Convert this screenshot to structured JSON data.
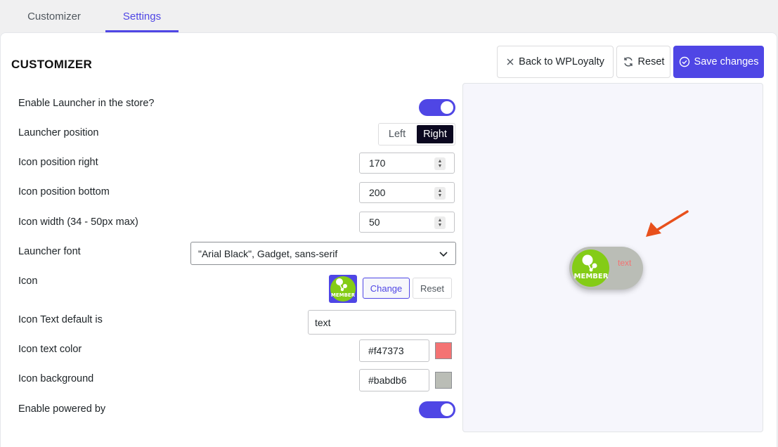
{
  "tabs": [
    {
      "label": "Customizer"
    },
    {
      "label": "Settings"
    }
  ],
  "page_title": "CUSTOMIZER",
  "actions": {
    "back": "Back to WPLoyalty",
    "reset": "Reset",
    "save": "Save changes"
  },
  "settings": {
    "enable_launcher": {
      "label": "Enable Launcher in the store?",
      "on": true
    },
    "launcher_position": {
      "label": "Launcher position",
      "options": [
        "Left",
        "Right"
      ],
      "selected": "Right"
    },
    "icon_position_right": {
      "label": "Icon position right",
      "value": "170"
    },
    "icon_position_bottom": {
      "label": "Icon position bottom",
      "value": "200"
    },
    "icon_width": {
      "label": "Icon width (34 - 50px max)",
      "value": "50"
    },
    "launcher_font": {
      "label": "Launcher font",
      "value": "\"Arial Black\", Gadget, sans-serif"
    },
    "icon": {
      "label": "Icon",
      "change": "Change",
      "reset": "Reset",
      "badge_text": "MEMBER"
    },
    "icon_text": {
      "label": "Icon Text default is",
      "value": "text"
    },
    "icon_text_color": {
      "label": "Icon text color",
      "value": "#f47373"
    },
    "icon_background": {
      "label": "Icon background",
      "value": "#babdb6"
    },
    "enable_powered_by": {
      "label": "Enable powered by",
      "on": true
    }
  },
  "preview": {
    "launcher_text": "text",
    "badge_text": "MEMBER",
    "text_color": "#f47373",
    "background": "#babdb6",
    "badge_color": "#84cc16",
    "arrow_color": "#e8501c"
  },
  "colors": {
    "accent": "#4f46e5"
  }
}
